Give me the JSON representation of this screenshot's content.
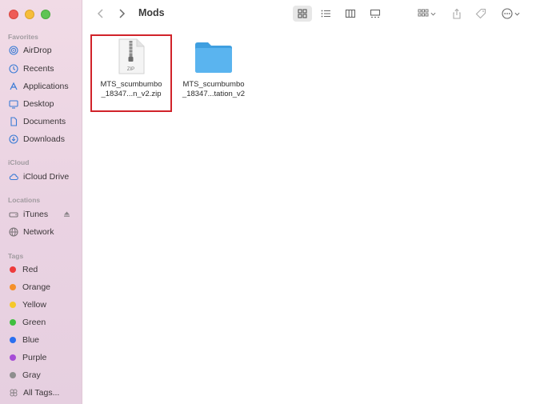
{
  "window": {
    "folder_title": "Mods"
  },
  "sidebar": {
    "sections": {
      "favorites": "Favorites",
      "icloud": "iCloud",
      "locations": "Locations",
      "tags": "Tags"
    },
    "favorites": [
      {
        "label": "AirDrop",
        "icon": "airdrop-icon"
      },
      {
        "label": "Recents",
        "icon": "clock-icon"
      },
      {
        "label": "Applications",
        "icon": "applications-icon"
      },
      {
        "label": "Desktop",
        "icon": "desktop-icon"
      },
      {
        "label": "Documents",
        "icon": "document-icon"
      },
      {
        "label": "Downloads",
        "icon": "download-icon"
      }
    ],
    "icloud": [
      {
        "label": "iCloud Drive",
        "icon": "cloud-icon"
      }
    ],
    "locations": [
      {
        "label": "iTunes",
        "icon": "drive-icon"
      },
      {
        "label": "Network",
        "icon": "globe-icon"
      }
    ],
    "tags": [
      {
        "label": "Red",
        "color": "#ee3b3b"
      },
      {
        "label": "Orange",
        "color": "#f5902a"
      },
      {
        "label": "Yellow",
        "color": "#f5c82a"
      },
      {
        "label": "Green",
        "color": "#3fbf3f"
      },
      {
        "label": "Blue",
        "color": "#2a6ff0"
      },
      {
        "label": "Purple",
        "color": "#a64cd6"
      },
      {
        "label": "Gray",
        "color": "#8e8e8e"
      },
      {
        "label": "All Tags...",
        "color": ""
      }
    ]
  },
  "files": [
    {
      "name_line1": "MTS_scumbumbo",
      "name_line2": "_18347...n_v2.zip",
      "type": "zip",
      "zip_label": "ZIP",
      "selected": true
    },
    {
      "name_line1": "MTS_scumbumbo",
      "name_line2": "_18347...tation_v2",
      "type": "folder",
      "selected": false
    }
  ],
  "colors": {
    "highlight": "#d1232a",
    "folder": "#5ab4ef"
  }
}
